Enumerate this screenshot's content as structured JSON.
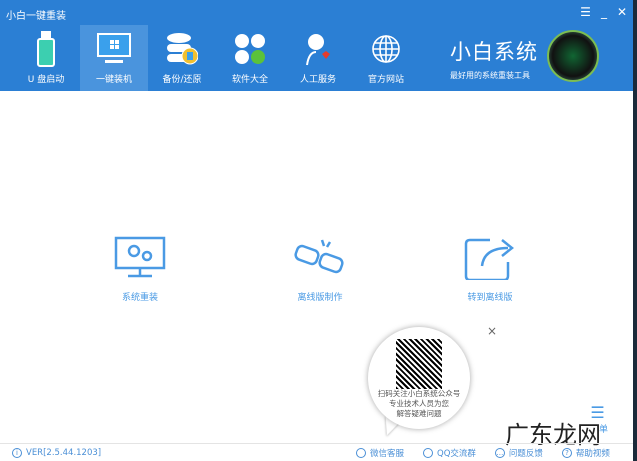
{
  "title": "小白一键重装",
  "window_controls": {
    "menu": "☰",
    "minimize": "_",
    "close": "✕"
  },
  "nav": [
    {
      "label": "U 盘启动",
      "icon": "usb-icon"
    },
    {
      "label": "一键装机",
      "icon": "monitor-windows-icon",
      "active": true
    },
    {
      "label": "备份/还原",
      "icon": "database-icon"
    },
    {
      "label": "软件大全",
      "icon": "apps-icon"
    },
    {
      "label": "人工服务",
      "icon": "person-heart-icon"
    },
    {
      "label": "官方网站",
      "icon": "globe-icon"
    }
  ],
  "brand": {
    "name": "小白系统",
    "slogan": "最好用的系统重装工具"
  },
  "features": [
    {
      "label": "系统重装",
      "icon": "monitor-gear-icon"
    },
    {
      "label": "离线版制作",
      "icon": "broken-link-icon"
    },
    {
      "label": "转到离线版",
      "icon": "share-icon"
    }
  ],
  "popup": {
    "lines": [
      "扫码关注小白系统公众号",
      "专业技术人员为您",
      "解答疑难问题"
    ],
    "close": "×"
  },
  "menu_label": "单",
  "watermark": "广东龙网",
  "footer": {
    "version": "VER[2.5.44.1203]",
    "links": [
      {
        "label": "微信客服",
        "icon": "wechat-icon"
      },
      {
        "label": "QQ交流群",
        "icon": "qq-icon"
      },
      {
        "label": "问题反馈",
        "icon": "chat-icon"
      },
      {
        "label": "帮助视频",
        "icon": "help-icon"
      }
    ]
  }
}
